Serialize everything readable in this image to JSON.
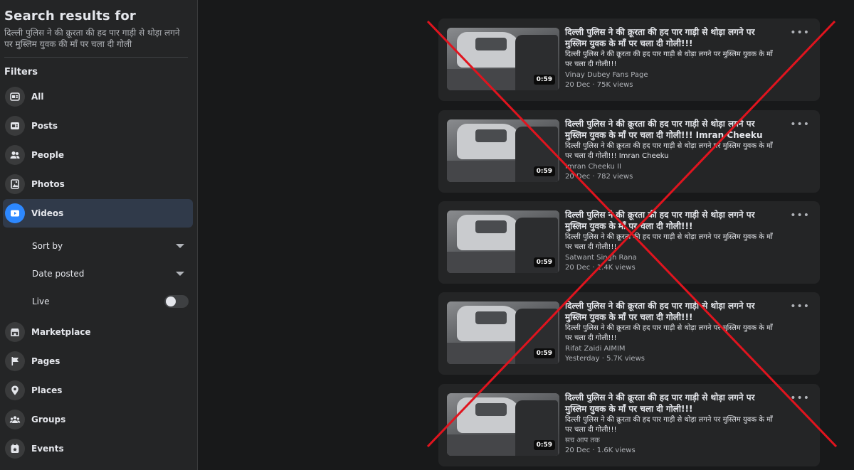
{
  "sidebar": {
    "heading": "Search results for",
    "query": "दिल्ली पुलिस ने की क्रूरता की हद पार गाड़ी से थोड़ा लगने पर मुस्लिम युवक की माँ पर चला दी गोली",
    "filters_label": "Filters",
    "nav": [
      {
        "label": "All",
        "icon": "all-icon"
      },
      {
        "label": "Posts",
        "icon": "posts-icon"
      },
      {
        "label": "People",
        "icon": "people-icon"
      },
      {
        "label": "Photos",
        "icon": "photos-icon"
      },
      {
        "label": "Videos",
        "icon": "videos-icon",
        "active": true
      },
      {
        "label": "Marketplace",
        "icon": "marketplace-icon"
      },
      {
        "label": "Pages",
        "icon": "pages-icon"
      },
      {
        "label": "Places",
        "icon": "places-icon"
      },
      {
        "label": "Groups",
        "icon": "groups-icon"
      },
      {
        "label": "Events",
        "icon": "events-icon"
      }
    ],
    "video_filters": {
      "sort_by": "Sort by",
      "date_posted": "Date posted",
      "live": "Live",
      "live_on": false
    }
  },
  "results": [
    {
      "title": "दिल्ली पुलिस ने की क्रूरता की हद पार गाड़ी से थोड़ा लगने पर मुस्लिम युवक के माँ पर चला दी गोली!!!",
      "desc": "दिल्ली पुलिस ने की क्रूरता की हद पार गाड़ी से थोड़ा लगने पर मुस्लिम युवक के माँ पर चला दी गोली!!!",
      "author": "Vinay Dubey Fans Page",
      "meta": "20 Dec · 75K views",
      "duration": "0:59"
    },
    {
      "title": "दिल्ली पुलिस ने की क्रूरता की हद पार गाड़ी से थोड़ा लगने पर मुस्लिम युवक के माँ पर चला दी गोली!!! Imran Cheeku",
      "desc": "दिल्ली पुलिस ने की क्रूरता की हद पार गाड़ी से थोड़ा लगने पर मुस्लिम युवक के माँ पर चला दी गोली!!! Imran Cheeku",
      "author": "Imran Cheeku II",
      "meta": "20 Dec · 782 views",
      "duration": "0:59"
    },
    {
      "title": "दिल्ली पुलिस ने की क्रूरता की हद पार गाड़ी से थोड़ा लगने पर मुस्लिम युवक के माँ पर चला दी गोली!!!",
      "desc": "दिल्ली पुलिस ने की क्रूरता की हद पार गाड़ी से थोड़ा लगने पर मुस्लिम युवक के माँ पर चला दी गोली!!!",
      "author": "Satwant Singh Rana",
      "meta": "20 Dec · 1.4K views",
      "duration": "0:59"
    },
    {
      "title": "दिल्ली पुलिस ने की क्रूरता की हद पार गाड़ी से थोड़ा लगने पर मुस्लिम युवक के माँ पर चला दी गोली!!!",
      "desc": "दिल्ली पुलिस ने की क्रूरता की हद पार गाड़ी से थोड़ा लगने पर मुस्लिम युवक के माँ पर चला दी गोली!!!",
      "author": "Rifat Zaidi AIMIM",
      "meta": "Yesterday · 5.7K views",
      "duration": "0:59"
    },
    {
      "title": "दिल्ली पुलिस ने की क्रूरता की हद पार गाड़ी से थोड़ा लगने पर मुस्लिम युवक के माँ पर चला दी गोली!!!",
      "desc": "दिल्ली पुलिस ने की क्रूरता की हद पार गाड़ी से थोड़ा लगने पर मुस्लिम युवक के माँ पर चला दी गोली!!!",
      "author": "सच आप तक",
      "meta": "20 Dec · 1.6K views",
      "duration": "0:59"
    }
  ],
  "more_glyph": "•••",
  "colors": {
    "background": "#18191a",
    "panel": "#242526",
    "accent": "#2d88ff",
    "cross_mark": "#e0141e"
  }
}
